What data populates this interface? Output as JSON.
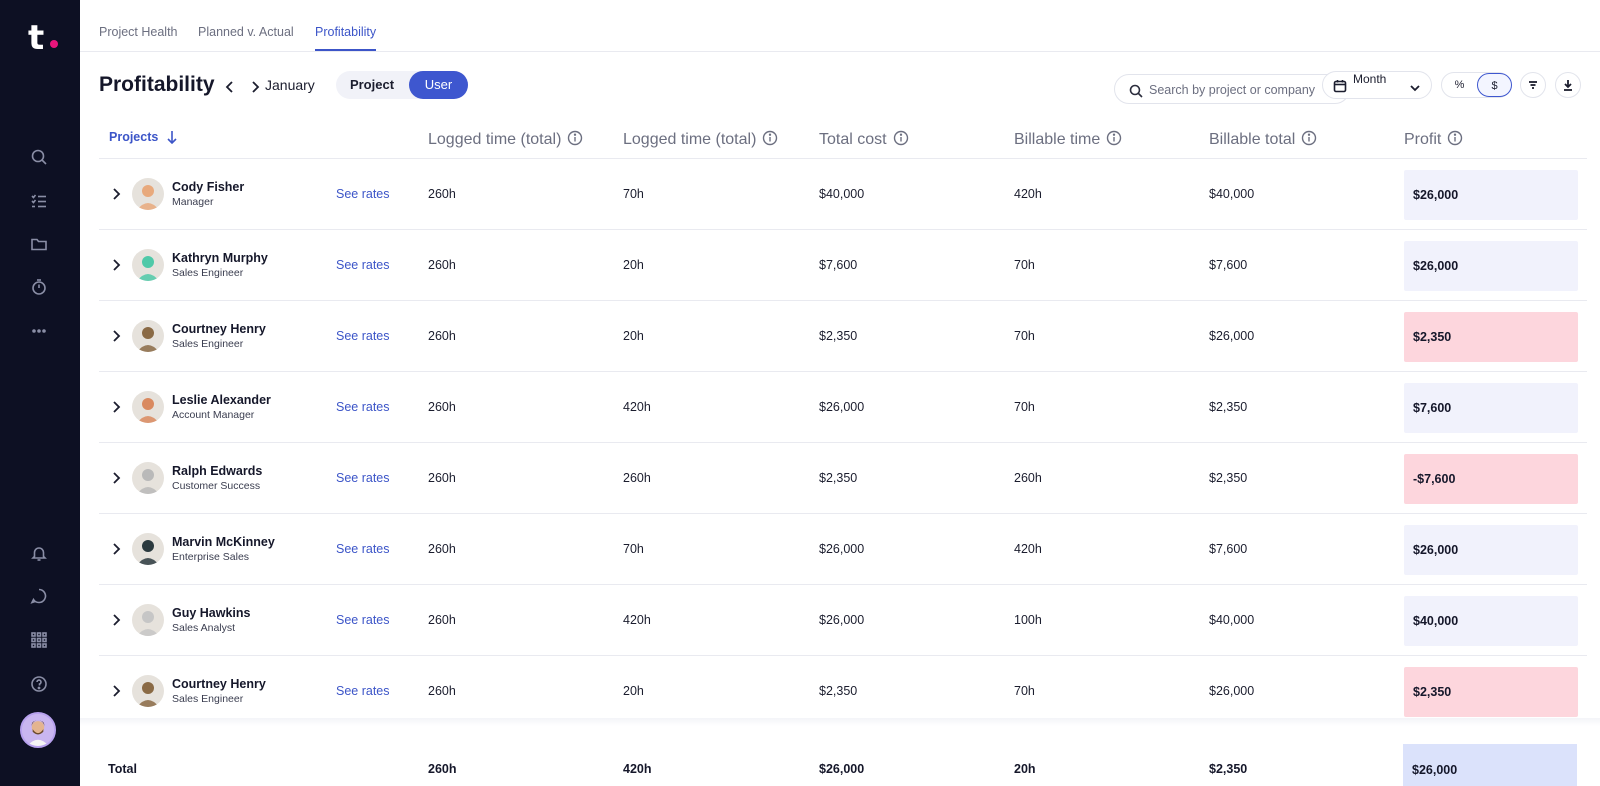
{
  "tabs": [
    {
      "label": "Project Health"
    },
    {
      "label": "Planned v. Actual"
    },
    {
      "label": "Profitability"
    }
  ],
  "header": {
    "title": "Profitability",
    "month": "January",
    "view_toggle": {
      "project": "Project",
      "user": "User",
      "selected": "User"
    },
    "search_placeholder": "Search by project or company",
    "period": "Month",
    "unit_toggle": {
      "percent": "%",
      "dollar": "$",
      "selected": "$"
    }
  },
  "columns": {
    "projects": "Projects",
    "logged_time_1": "Logged time (total)",
    "logged_time_2": "Logged time (total)",
    "total_cost": "Total cost",
    "billable_time": "Billable time",
    "billable_total": "Billable total",
    "profit": "Profit"
  },
  "rates_label": "See rates",
  "rows": [
    {
      "name": "Cody Fisher",
      "role": "Manager",
      "logged1": "260h",
      "logged2": "70h",
      "cost": "$40,000",
      "billable_time": "420h",
      "billable_total": "$40,000",
      "profit": "$26,000",
      "profit_status": "pos"
    },
    {
      "name": "Kathryn Murphy",
      "role": "Sales Engineer",
      "logged1": "260h",
      "logged2": "20h",
      "cost": "$7,600",
      "billable_time": "70h",
      "billable_total": "$7,600",
      "profit": "$26,000",
      "profit_status": "pos"
    },
    {
      "name": "Courtney Henry",
      "role": "Sales Engineer",
      "logged1": "260h",
      "logged2": "20h",
      "cost": "$2,350",
      "billable_time": "70h",
      "billable_total": "$26,000",
      "profit": "$2,350",
      "profit_status": "neg"
    },
    {
      "name": "Leslie Alexander",
      "role": "Account Manager",
      "logged1": "260h",
      "logged2": "420h",
      "cost": "$26,000",
      "billable_time": "70h",
      "billable_total": "$2,350",
      "profit": "$7,600",
      "profit_status": "pos"
    },
    {
      "name": "Ralph Edwards",
      "role": "Customer Success",
      "logged1": "260h",
      "logged2": "260h",
      "cost": "$2,350",
      "billable_time": "260h",
      "billable_total": "$2,350",
      "profit": "-$7,600",
      "profit_status": "neg"
    },
    {
      "name": "Marvin McKinney",
      "role": "Enterprise Sales",
      "logged1": "260h",
      "logged2": "70h",
      "cost": "$26,000",
      "billable_time": "420h",
      "billable_total": "$7,600",
      "profit": "$26,000",
      "profit_status": "pos"
    },
    {
      "name": "Guy Hawkins",
      "role": "Sales Analyst",
      "logged1": "260h",
      "logged2": "420h",
      "cost": "$26,000",
      "billable_time": "100h",
      "billable_total": "$40,000",
      "profit": "$40,000",
      "profit_status": "pos"
    },
    {
      "name": "Courtney Henry",
      "role": "Sales Engineer",
      "logged1": "260h",
      "logged2": "20h",
      "cost": "$2,350",
      "billable_time": "70h",
      "billable_total": "$26,000",
      "profit": "$2,350",
      "profit_status": "neg"
    }
  ],
  "totals": {
    "label": "Total",
    "logged1": "260h",
    "logged2": "420h",
    "cost": "$26,000",
    "billable_time": "20h",
    "billable_total": "$2,350",
    "profit": "$26,000"
  },
  "colors": {
    "sidebar": "#0d1023",
    "accent": "#3e57cf",
    "logo_dot": "#e8157b",
    "profit_positive_bg": "#f1f2fc",
    "profit_negative_bg": "#fdd6dd",
    "total_profit_bg": "#dbe2fb"
  },
  "avatar_colors": [
    "#e8a97c",
    "#4fc9a8",
    "#8a6a45",
    "#d9895f",
    "#b9b9b9",
    "#2b3a3f",
    "#c6c6c6",
    "#8a6a45"
  ],
  "sidebar_icons": [
    "search-icon",
    "tasks-icon",
    "folder-icon",
    "timer-icon",
    "more-icon",
    "bell-icon",
    "chat-icon",
    "apps-grid-icon",
    "help-icon"
  ]
}
